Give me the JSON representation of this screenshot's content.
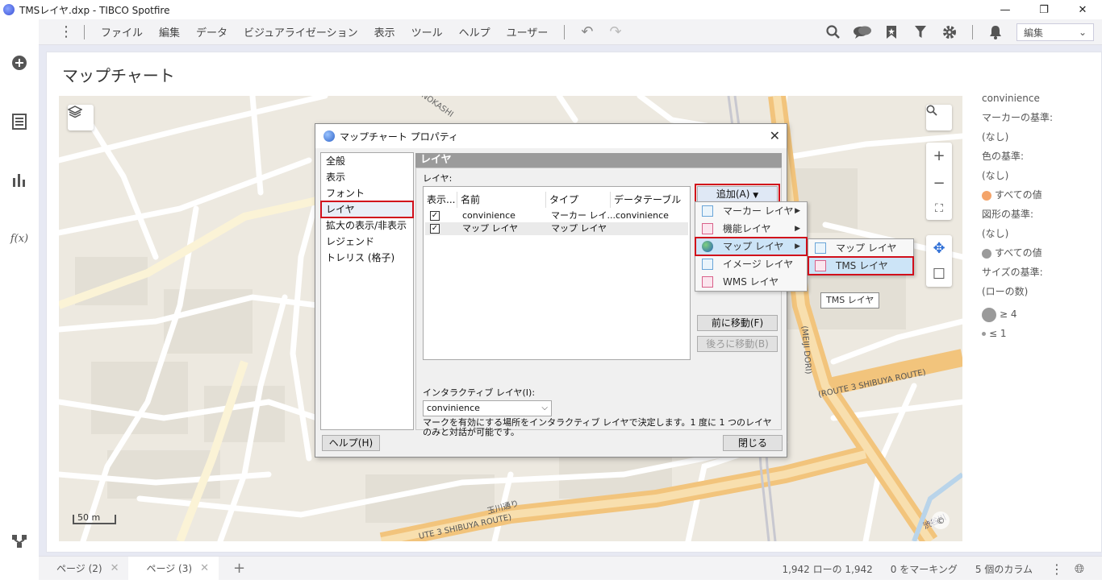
{
  "window": {
    "title": "TMSレイヤ.dxp - TIBCO Spotfire",
    "min": "—",
    "max": "❐",
    "close": "✕"
  },
  "menubar": {
    "items": [
      "ファイル",
      "編集",
      "データ",
      "ビジュアライゼーション",
      "表示",
      "ツール",
      "ヘルプ",
      "ユーザー"
    ],
    "mode_select": "編集"
  },
  "visualization": {
    "title": "マップチャート"
  },
  "map": {
    "scale_label": "50 m",
    "copyright": "©",
    "labels": {
      "inokashira": "(INOKASHI",
      "route_3_right": "(ROUTE 3 SHIBUYA ROUTE)",
      "route_3_bottom": "UTE 3 SHIBUYA ROUTE)",
      "meiji": "(MEIJI DORI)",
      "tamagawa": "玉川通り",
      "shibuyagawa": "渋谷川"
    }
  },
  "legend": {
    "table_name": "convinience",
    "marker_by_label": "マーカーの基準:",
    "marker_by_value": "(なし)",
    "color_by_label": "色の基準:",
    "color_by_value": "(なし)",
    "color_all": "すべての値",
    "shape_by_label": "図形の基準:",
    "shape_by_value": "(なし)",
    "shape_all": "すべての値",
    "size_by_label": "サイズの基準:",
    "size_by_value": "(ローの数)",
    "size_max": "≥ 4",
    "size_min": "≤ 1",
    "colors": {
      "orange": "#f4a46a",
      "gray": "#9a9a9a"
    }
  },
  "dialog": {
    "title": "マップチャート プロパティ",
    "nav": [
      "全般",
      "表示",
      "フォント",
      "レイヤ",
      "拡大の表示/非表示",
      "レジェンド",
      "トレリス (格子)"
    ],
    "section_title": "レイヤ",
    "layers_label": "レイヤ:",
    "columns": [
      "表示...",
      "名前",
      "タイプ",
      "データテーブル"
    ],
    "rows": [
      {
        "checked": "✓",
        "name": "convinience",
        "type": "マーカー レイ...",
        "table": "convinience"
      },
      {
        "checked": "✓",
        "name": "マップ レイヤ",
        "type": "マップ レイヤ",
        "table": ""
      }
    ],
    "add_button": "追加(A)",
    "move_up": "前に移動(F)",
    "move_down": "後ろに移動(B)",
    "interactive_label": "インタラクティブ レイヤ(I):",
    "interactive_value": "convinience",
    "description": "マークを有効にする場所をインタラクティブ レイヤで決定します。1 度に 1 つのレイヤのみと対話が可能です。",
    "help_button": "ヘルプ(H)",
    "close_button": "閉じる"
  },
  "add_menu": {
    "items": [
      "マーカー レイヤ",
      "機能レイヤ",
      "マップ レイヤ",
      "イメージ レイヤ",
      "WMS レイヤ"
    ]
  },
  "map_submenu": {
    "items": [
      "マップ レイヤ",
      "TMS レイヤ"
    ]
  },
  "tooltip": "TMS レイヤ",
  "tabs": [
    {
      "label": "ページ (2)"
    },
    {
      "label": "ページ (3)"
    }
  ],
  "status": {
    "rows": "1,942 ローの 1,942",
    "marked": "0 をマーキング",
    "columns": "5 個のカラム"
  }
}
